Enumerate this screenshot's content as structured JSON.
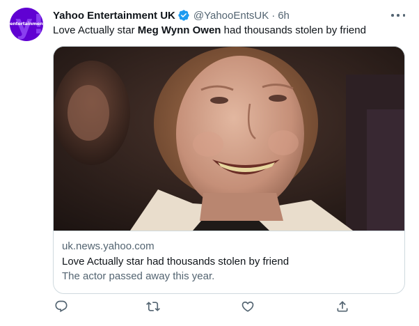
{
  "tweet": {
    "avatar": {
      "text": "entertainment",
      "letter": "y!",
      "bg_color": "#6001d2"
    },
    "display_name": "Yahoo Entertainment UK",
    "verified": true,
    "verified_color": "#1d9bf0",
    "handle": "@YahooEntsUK",
    "separator": "·",
    "time": "6h",
    "text_before": "Love Actually star ",
    "text_bold": "Meg Wynn Owen",
    "text_after": " had thousands stolen by friend",
    "card": {
      "image": "photo-of-smiling-woman",
      "domain": "uk.news.yahoo.com",
      "title": "Love Actually star had thousands stolen by friend",
      "description": "The actor passed away this year."
    },
    "actions": [
      "reply-icon",
      "retweet-icon",
      "like-icon",
      "share-icon"
    ]
  }
}
